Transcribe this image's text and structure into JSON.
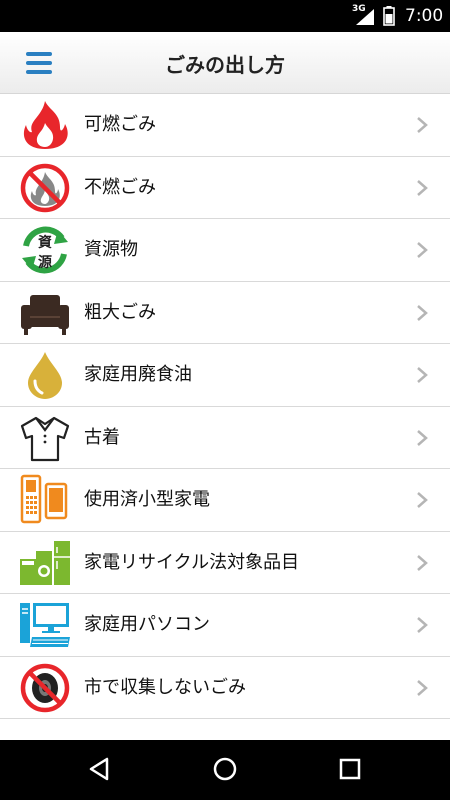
{
  "status_bar": {
    "network": "3G",
    "time": "7:00"
  },
  "header": {
    "title": "ごみの出し方"
  },
  "items": [
    {
      "label": "可燃ごみ",
      "icon": "fire-icon"
    },
    {
      "label": "不燃ごみ",
      "icon": "no-burn-icon"
    },
    {
      "label": "資源物",
      "icon": "recycle-icon"
    },
    {
      "label": "粗大ごみ",
      "icon": "sofa-icon"
    },
    {
      "label": "家庭用廃食油",
      "icon": "oil-drop-icon"
    },
    {
      "label": "古着",
      "icon": "shirt-icon"
    },
    {
      "label": "使用済小型家電",
      "icon": "phone-icon"
    },
    {
      "label": "家電リサイクル法対象品目",
      "icon": "appliance-icon"
    },
    {
      "label": "家庭用パソコン",
      "icon": "computer-icon"
    },
    {
      "label": "市で収集しないごみ",
      "icon": "no-tire-icon"
    }
  ],
  "icon_text": {
    "recycle_top": "資",
    "recycle_bottom": "源"
  },
  "colors": {
    "accent": "#2a7fc1",
    "fire": "#e8262b",
    "recycle": "#2fa344",
    "orange": "#f08a1e",
    "cyan": "#1ba3d8",
    "lime": "#7cb82f",
    "oil": "#d8b13a"
  }
}
